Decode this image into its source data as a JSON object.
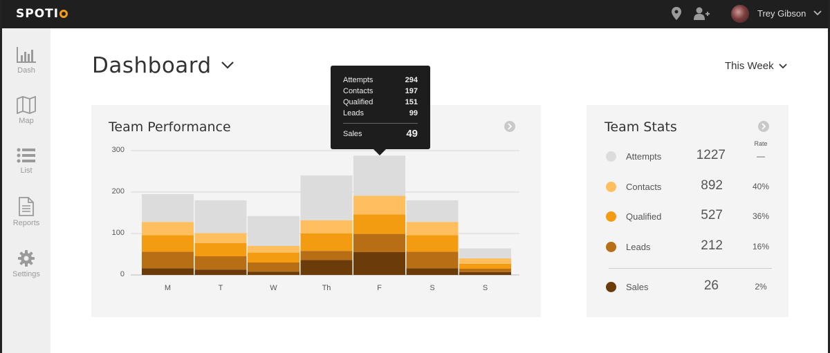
{
  "app": {
    "brand": "SPOTI"
  },
  "topbar": {
    "user_name": "Trey Gibson",
    "icons": [
      "location-pin-icon",
      "add-user-icon",
      "chevron-down-icon"
    ]
  },
  "sidebar": {
    "items": [
      {
        "label": "Dash",
        "icon": "bar-chart-icon"
      },
      {
        "label": "Map",
        "icon": "map-icon"
      },
      {
        "label": "List",
        "icon": "list-icon"
      },
      {
        "label": "Reports",
        "icon": "document-icon"
      },
      {
        "label": "Settings",
        "icon": "gear-icon"
      }
    ]
  },
  "header": {
    "title": "Dashboard",
    "date_range": "This Week"
  },
  "performance": {
    "title": "Team Performance",
    "tooltip": {
      "rows": [
        {
          "label": "Attempts",
          "value": "294"
        },
        {
          "label": "Contacts",
          "value": "197"
        },
        {
          "label": "Qualified",
          "value": "151"
        },
        {
          "label": "Leads",
          "value": "99"
        }
      ],
      "sales": {
        "label": "Sales",
        "value": "49"
      }
    }
  },
  "colors": {
    "attempts": "#dcdcdc",
    "contacts": "#ffbf5e",
    "qualified": "#f39c12",
    "leads": "#b76e14",
    "sales": "#6b3b0a",
    "brand_orange": "#f39c12",
    "topbar": "#1f1f1f"
  },
  "chart_data": {
    "type": "bar",
    "stacked": true,
    "categories": [
      "M",
      "T",
      "W",
      "Th",
      "F",
      "S",
      "S"
    ],
    "ylim": [
      0,
      300
    ],
    "yticks": [
      "0",
      "100",
      "200",
      "300"
    ],
    "grid": true,
    "series": [
      {
        "name": "Sales",
        "color": "#6b3b0a",
        "values": [
          16,
          13,
          8,
          36,
          55,
          16,
          7
        ]
      },
      {
        "name": "Leads",
        "color": "#b76e14",
        "values": [
          40,
          32,
          22,
          22,
          44,
          40,
          8
        ]
      },
      {
        "name": "Qualified",
        "color": "#f39c12",
        "values": [
          40,
          32,
          24,
          42,
          47,
          40,
          12
        ]
      },
      {
        "name": "Contacts",
        "color": "#ffbf5e",
        "values": [
          32,
          24,
          16,
          32,
          45,
          32,
          13
        ]
      },
      {
        "name": "Attempts",
        "color": "#dcdcdc",
        "values": [
          67,
          79,
          72,
          108,
          97,
          52,
          24
        ]
      }
    ]
  },
  "stats": {
    "title": "Team Stats",
    "rate_header": "Rate",
    "rows": [
      {
        "label": "Attempts",
        "value": "1227",
        "rate": "—",
        "color": "#dcdcdc"
      },
      {
        "label": "Contacts",
        "value": "892",
        "rate": "40%",
        "color": "#ffbf5e"
      },
      {
        "label": "Qualified",
        "value": "527",
        "rate": "36%",
        "color": "#f39c12"
      },
      {
        "label": "Leads",
        "value": "212",
        "rate": "16%",
        "color": "#b76e14"
      }
    ],
    "total": {
      "label": "Sales",
      "value": "26",
      "rate": "2%",
      "color": "#6b3b0a"
    }
  }
}
